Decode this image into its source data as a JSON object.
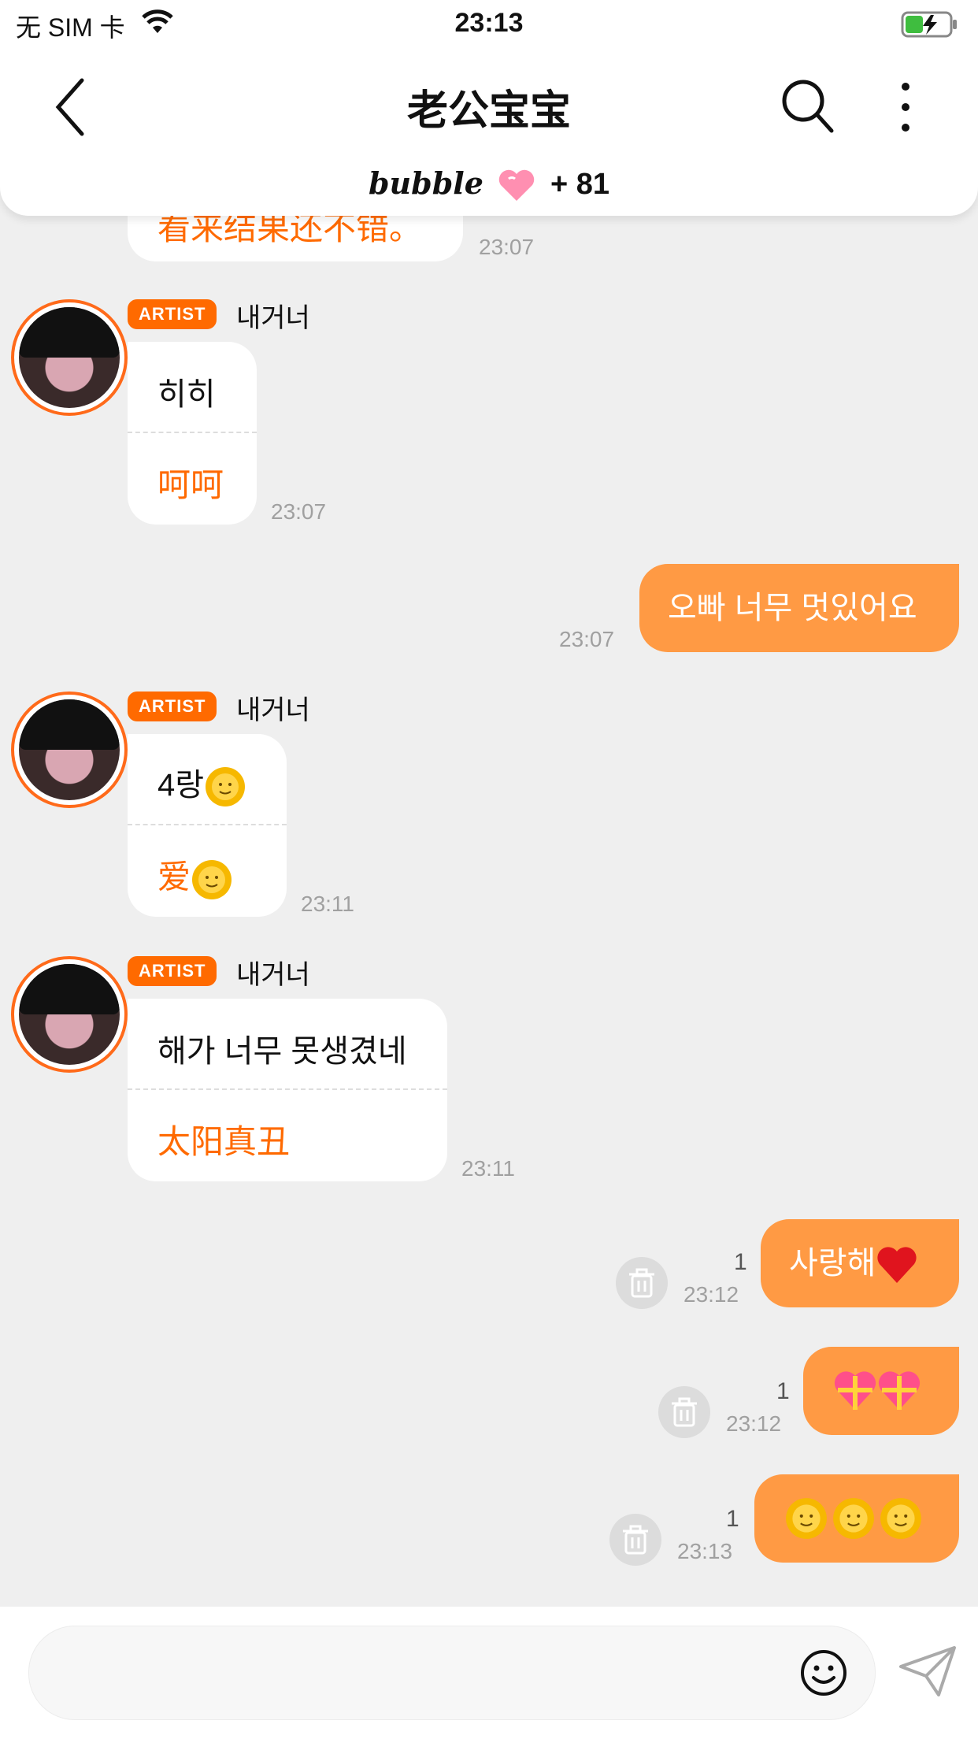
{
  "status_bar": {
    "carrier": "无 SIM 卡",
    "time": "23:13"
  },
  "header": {
    "title": "老公宝宝",
    "bubble_brand": "bubble",
    "bubble_count": "+ 81"
  },
  "messages": {
    "m0": {
      "zh": "看来结果还不错。",
      "time": "23:07"
    },
    "m1": {
      "badge": "ARTIST",
      "sender": "내거너",
      "ko": "히히",
      "zh": "呵呵",
      "time": "23:07"
    },
    "m2": {
      "text": "오빠 너무 멋있어요",
      "time": "23:07"
    },
    "m3": {
      "badge": "ARTIST",
      "sender": "내거너",
      "ko": "4랑",
      "zh": "爱",
      "time": "23:11"
    },
    "m4": {
      "badge": "ARTIST",
      "sender": "내거너",
      "ko": "해가 너무 못생겼네",
      "zh": "太阳真丑",
      "time": "23:11"
    },
    "m5": {
      "text": "사랑해",
      "unread": "1",
      "time": "23:12"
    },
    "m6": {
      "unread": "1",
      "time": "23:12"
    },
    "m7": {
      "unread": "1",
      "time": "23:13"
    }
  },
  "colors": {
    "accent": "#ff6a00",
    "outgoing": "#ff9a44",
    "background": "#efefef"
  },
  "icons": [
    "back-icon",
    "search-icon",
    "more-icon",
    "heart-icon",
    "sun-emoji",
    "gift-heart-emoji",
    "red-heart-emoji",
    "trash-icon",
    "smiley-icon",
    "send-icon",
    "wifi-icon",
    "battery-icon"
  ]
}
